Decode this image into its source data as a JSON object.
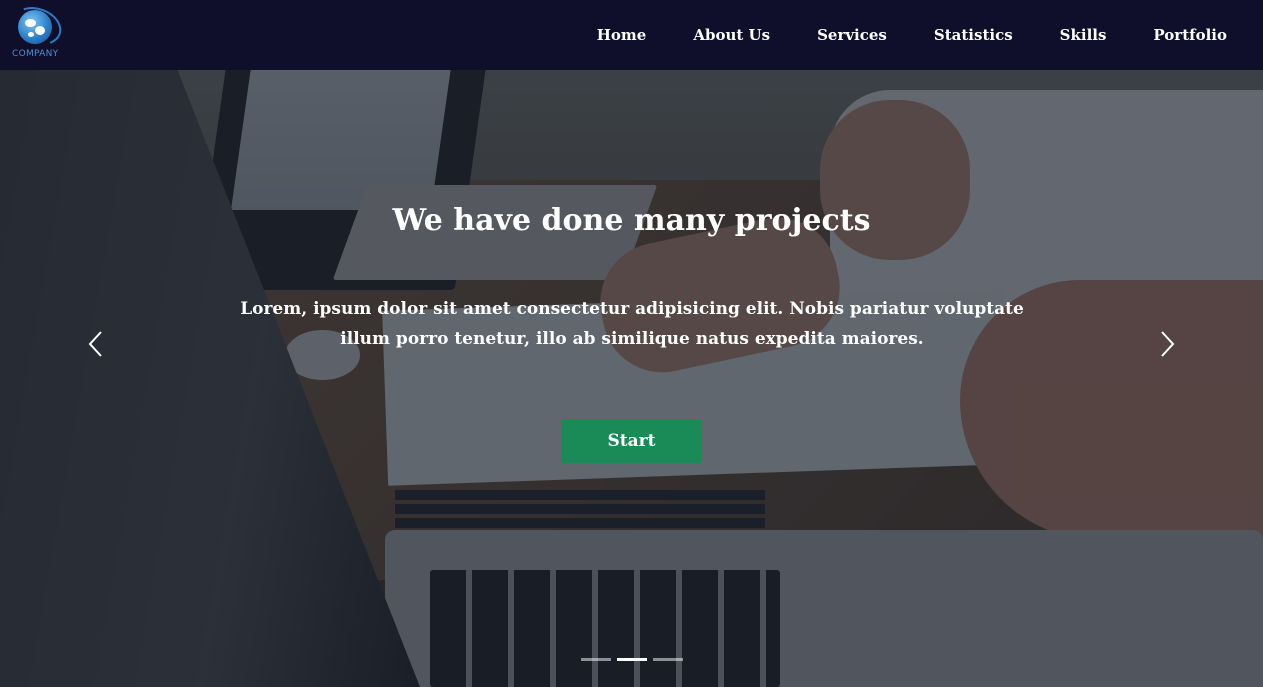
{
  "navbar": {
    "logo_text": "COMPANY",
    "items": [
      {
        "label": "Home"
      },
      {
        "label": "About Us"
      },
      {
        "label": "Services"
      },
      {
        "label": "Statistics"
      },
      {
        "label": "Skills"
      },
      {
        "label": "Portfolio"
      }
    ]
  },
  "carousel": {
    "title": "We have done many projects",
    "text": "Lorem, ipsum dolor sit amet consectetur adipisicing elit. Nobis pariatur voluptate illum porro tenetur, illo ab similique natus expedita maiores.",
    "button_label": "Start",
    "prev_icon": "chevron-left-icon",
    "next_icon": "chevron-right-icon",
    "slide_count": 3,
    "active_slide": 2
  },
  "colors": {
    "navbar_bg": "#0f0f2b",
    "button_bg": "#1a8a56",
    "text": "#ffffff",
    "logo_blue": "#4d8fd6"
  }
}
